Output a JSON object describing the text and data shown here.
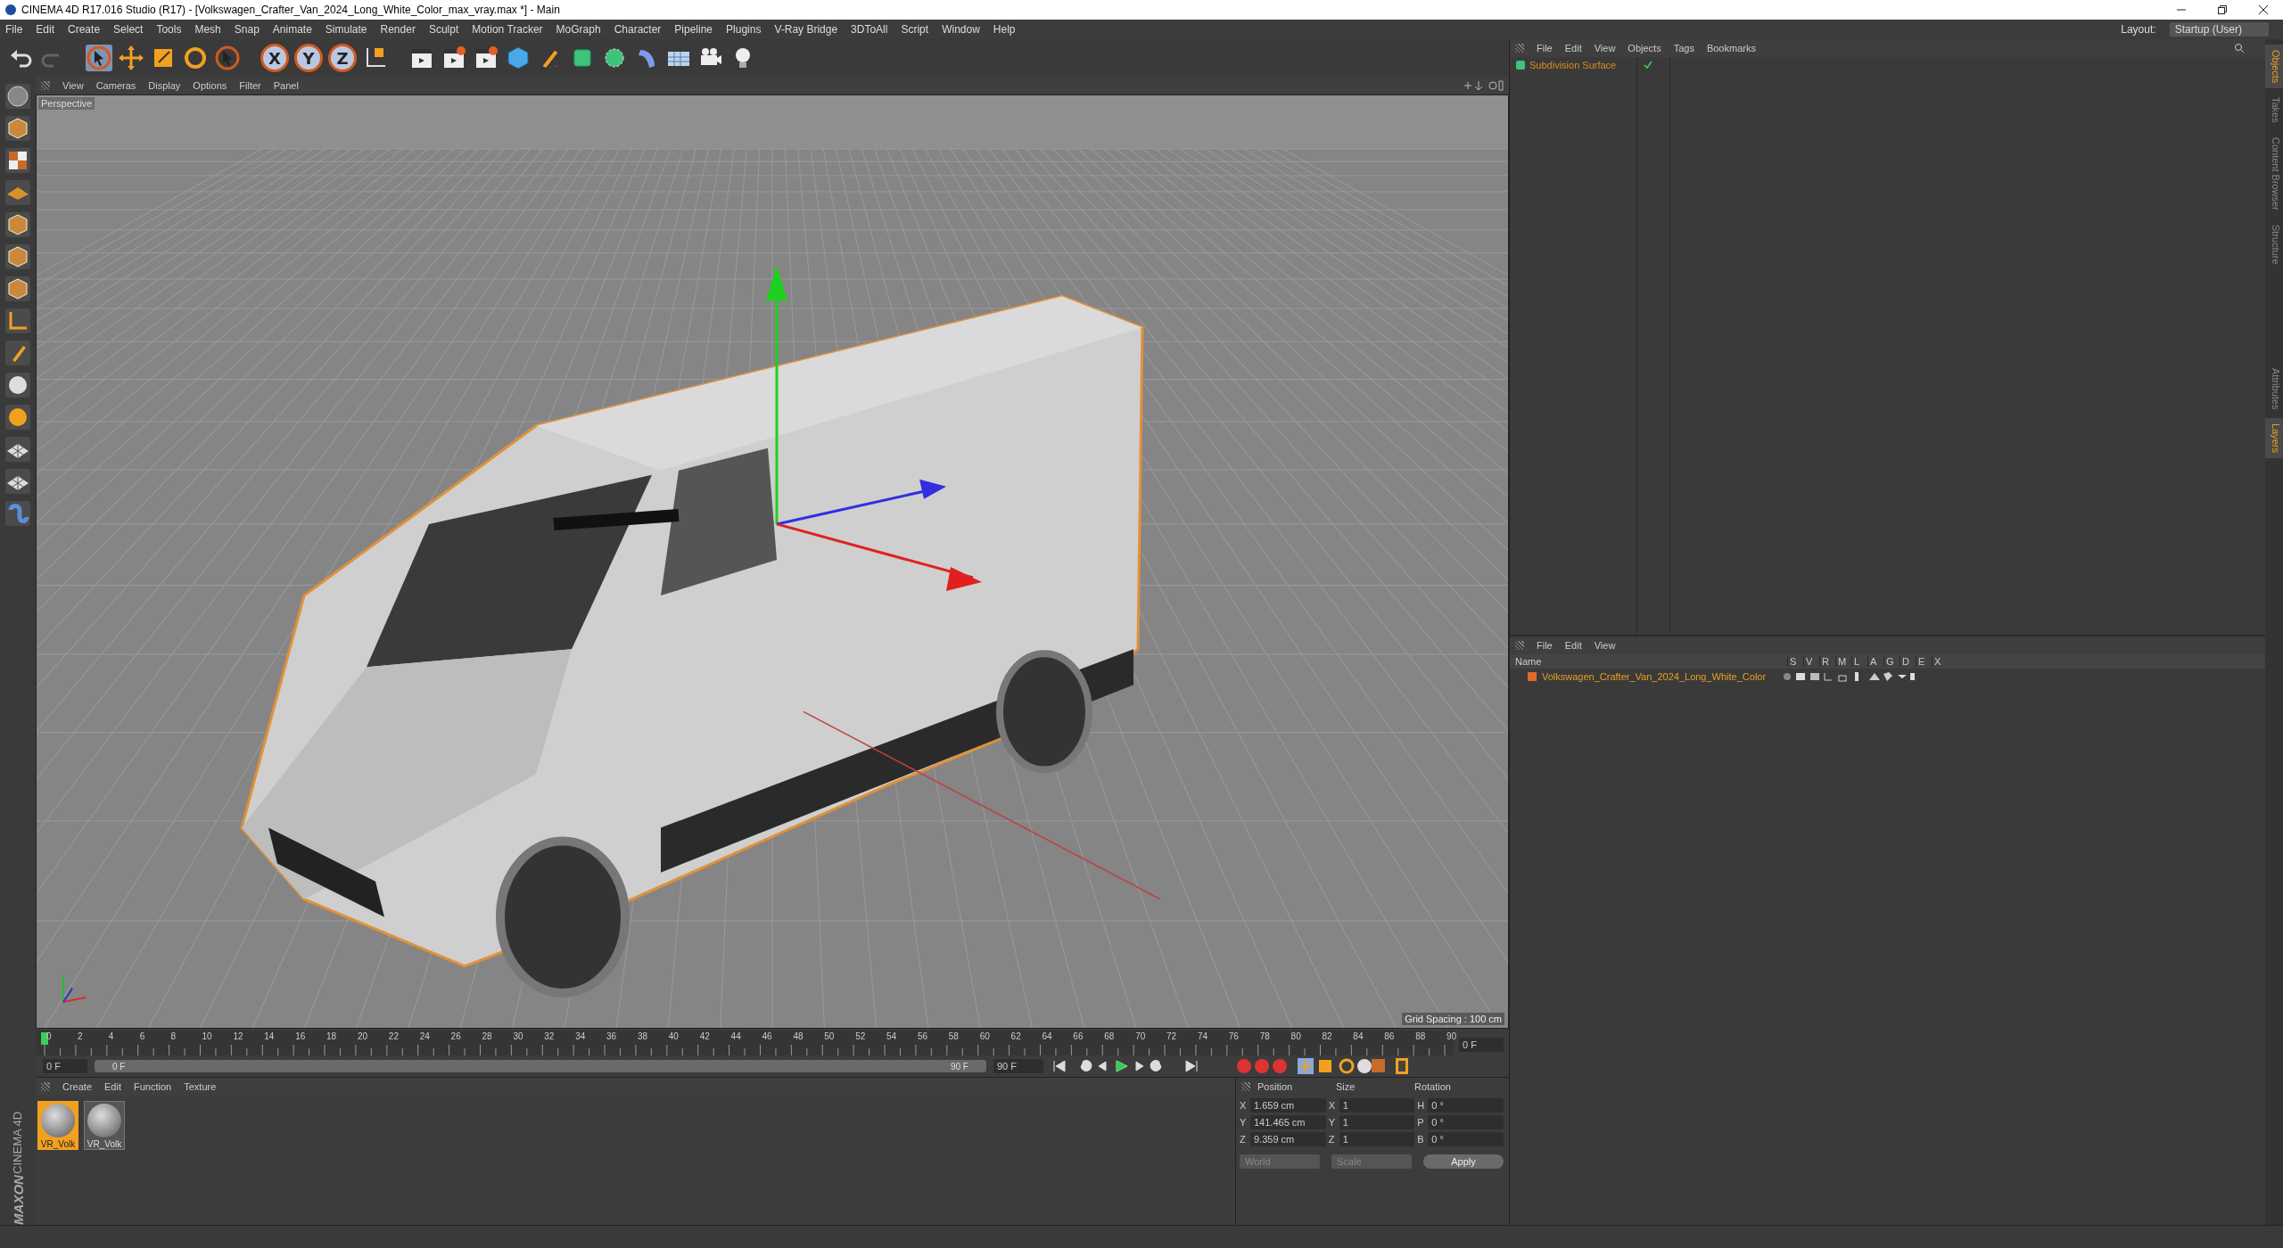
{
  "window": {
    "title": "CINEMA 4D R17.016 Studio (R17) - [Volkswagen_Crafter_Van_2024_Long_White_Color_max_vray.max *] - Main"
  },
  "menu": [
    "File",
    "Edit",
    "Create",
    "Select",
    "Tools",
    "Mesh",
    "Snap",
    "Animate",
    "Simulate",
    "Render",
    "Sculpt",
    "Motion Tracker",
    "MoGraph",
    "Character",
    "Pipeline",
    "Plugins",
    "V-Ray Bridge",
    "3DToAll",
    "Script",
    "Window",
    "Help"
  ],
  "layout": {
    "label": "Layout:",
    "value": "Startup (User)"
  },
  "toolbar": {
    "axis_buttons": [
      {
        "label": "X",
        "selected": true
      },
      {
        "label": "Y",
        "selected": true
      },
      {
        "label": "Z",
        "selected": true
      }
    ]
  },
  "viewport": {
    "menu": [
      "View",
      "Cameras",
      "Display",
      "Options",
      "Filter",
      "Panel"
    ],
    "camera": "Perspective",
    "grid_spacing": "Grid Spacing : 100 cm"
  },
  "timeline": {
    "ticks": [
      "0",
      "2",
      "4",
      "6",
      "8",
      "10",
      "12",
      "14",
      "16",
      "18",
      "20",
      "22",
      "24",
      "26",
      "28",
      "30",
      "32",
      "34",
      "36",
      "38",
      "40",
      "42",
      "44",
      "46",
      "48",
      "50",
      "52",
      "54",
      "56",
      "58",
      "60",
      "62",
      "64",
      "66",
      "68",
      "70",
      "72",
      "74",
      "76",
      "78",
      "80",
      "82",
      "84",
      "86",
      "88",
      "90"
    ],
    "current_frame": "0 F",
    "start_field": "0 F",
    "range": {
      "level": 1
    },
    "range_start": "0 F",
    "range_end": "90 F",
    "end_field": "90 F"
  },
  "materials": {
    "menu": [
      "Create",
      "Edit",
      "Function",
      "Texture"
    ],
    "items": [
      {
        "name": "VR_Volk",
        "selected": true
      },
      {
        "name": "VR_Volk",
        "selected": false
      }
    ]
  },
  "coordinates": {
    "headers": [
      "Position",
      "Size",
      "Rotation"
    ],
    "rows": [
      {
        "axis": "X",
        "position": "1.659 cm",
        "size_axis": "X",
        "size": "1",
        "rot_axis": "H",
        "rotation": "0 °"
      },
      {
        "axis": "Y",
        "position": "141.465 cm",
        "size_axis": "Y",
        "size": "1",
        "rot_axis": "P",
        "rotation": "0 °"
      },
      {
        "axis": "Z",
        "position": "9.359 cm",
        "size_axis": "Z",
        "size": "1",
        "rot_axis": "B",
        "rotation": "0 °"
      }
    ],
    "space": "World",
    "mode": "Scale",
    "apply": "Apply"
  },
  "objects": {
    "menu": [
      "File",
      "Edit",
      "View",
      "Objects",
      "Tags",
      "Bookmarks"
    ],
    "items": [
      {
        "name": "Subdivision Surface",
        "enabled": true
      }
    ]
  },
  "layers": {
    "menu": [
      "File",
      "Edit",
      "View"
    ],
    "columns": [
      "Name",
      "S",
      "V",
      "R",
      "M",
      "L",
      "A",
      "G",
      "D",
      "E",
      "X"
    ],
    "items": [
      {
        "name": "Volkswagen_Crafter_Van_2024_Long_White_Color",
        "color": "#e0692c"
      }
    ]
  },
  "side_tabs_top": [
    {
      "label": "Objects",
      "selected": true
    },
    {
      "label": "Takes",
      "selected": false
    },
    {
      "label": "Content Browser",
      "selected": false
    },
    {
      "label": "Structure",
      "selected": false
    }
  ],
  "side_tabs_bottom": [
    {
      "label": "Attributes",
      "selected": false
    },
    {
      "label": "Layers",
      "selected": true
    }
  ],
  "logo": {
    "brand": "MAXON",
    "product": "CINEMA 4D"
  }
}
